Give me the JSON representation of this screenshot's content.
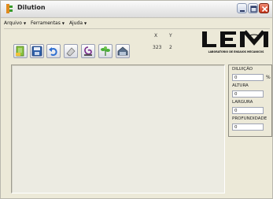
{
  "window": {
    "title": "Dilution"
  },
  "menu": {
    "items": [
      {
        "label": "Arquivo"
      },
      {
        "label": "Ferramentas"
      },
      {
        "label": "Ajuda"
      }
    ]
  },
  "toolbar": {
    "buttons": [
      {
        "icon": "open-file-icon"
      },
      {
        "icon": "save-icon"
      },
      {
        "icon": "undo-icon"
      },
      {
        "icon": "eraser-icon"
      },
      {
        "icon": "dilution-icon"
      },
      {
        "icon": "plant-icon"
      },
      {
        "icon": "export-icon"
      }
    ]
  },
  "coords": {
    "x_label": "X",
    "y_label": "Y",
    "x_value": "323",
    "y_value": "2"
  },
  "logo": {
    "text": "LEM",
    "subtitle": "LABORATORIO DE ENSAIOS MECANICOS"
  },
  "panel": {
    "dilucao_label": "DILUIÇÃO",
    "dilucao_value": "0",
    "dilucao_unit": "%",
    "altura_label": "ALTURA",
    "altura_value": "0",
    "largura_label": "LARGURA",
    "largura_value": "0",
    "profundidade_label": "PROFUNDIDADE",
    "profundidade_value": "0"
  }
}
